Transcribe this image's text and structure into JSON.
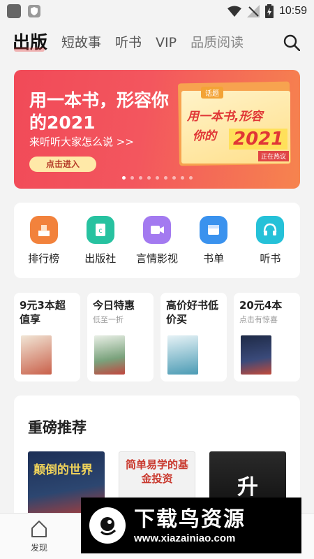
{
  "status_bar": {
    "time": "10:59"
  },
  "nav": {
    "tabs": [
      {
        "label": "出版"
      },
      {
        "label": "短故事"
      },
      {
        "label": "听书"
      },
      {
        "label": "VIP"
      },
      {
        "label": "品质阅读"
      }
    ]
  },
  "banner": {
    "title": "用一本书，形容你的2021",
    "subtitle": "来听听大家怎么说 >>",
    "button": "点击进入",
    "card_tag": "话题",
    "card_line1": "用一本书,形容",
    "card_line2": "你的",
    "card_year": "2021",
    "card_live": "正在热议",
    "dots": 9,
    "active_dot": 0
  },
  "categories": [
    {
      "label": "排行榜",
      "icon": "trophy-icon",
      "color": "#f2823c"
    },
    {
      "label": "出版社",
      "icon": "publisher-icon",
      "color": "#27c2a0"
    },
    {
      "label": "言情影视",
      "icon": "video-icon",
      "color": "#a37af0"
    },
    {
      "label": "书单",
      "icon": "booklist-icon",
      "color": "#3a92ee"
    },
    {
      "label": "听书",
      "icon": "headphones-icon",
      "color": "#25c1d8"
    }
  ],
  "promos": [
    {
      "title": "9元3本超值享",
      "sub": ""
    },
    {
      "title": "今日特惠",
      "sub": "低至一折"
    },
    {
      "title": "高价好书低价买",
      "sub": ""
    },
    {
      "title": "20元4本",
      "sub": "点击有惊喜"
    }
  ],
  "recommend": {
    "title": "重磅推荐",
    "books": [
      {
        "title": "颠倒的世界"
      },
      {
        "title": "简单易学的基金投资"
      },
      {
        "title": "升"
      }
    ]
  },
  "bottom_tabs": [
    {
      "label": "发现"
    }
  ],
  "watermark": {
    "name": "下载鸟资源",
    "url": "www.xiazainiao.com"
  },
  "colors": {
    "accent": "#f14a58",
    "background": "#f3f3f3"
  }
}
